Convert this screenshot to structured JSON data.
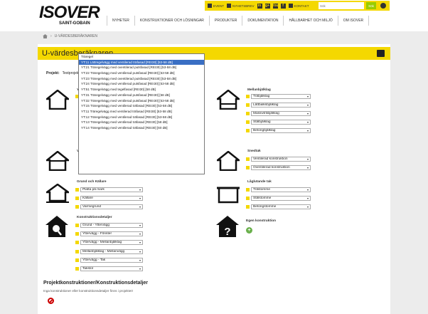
{
  "header": {
    "logo_text": "ISOVER",
    "logo_sub": "SAINT-GOBAIN",
    "topbar": {
      "event": "EVENT",
      "news": "NYHETSBREV",
      "contact": "KONTAKT",
      "social": [
        "in",
        "g+",
        "You",
        "f"
      ]
    },
    "search_placeholder": "Sök",
    "search_button": "Sök",
    "nav": [
      "NYHETER",
      "KONSTRUKTIONER OCH LÖSNINGAR",
      "PRODUKTER",
      "DOKUMENTATION",
      "HÅLLBARHET OCH MILJÖ",
      "OM ISOVER"
    ]
  },
  "breadcrumb": {
    "current": "U-VÄRDESBERÄKNAREN"
  },
  "page": {
    "title": "U-värdesberäknaren",
    "project_label": "Projekt:",
    "project_value": "Testprojekt"
  },
  "sections": {
    "yttervaggar": {
      "title": "Ytterväggar",
      "selected": "Träregel"
    },
    "mellanbjalklag": {
      "title": "Mellanbjälklag",
      "items": [
        "Träbjälklag",
        "Lättbalksbjälklag",
        "Massivträbjälklag",
        "Stålbjälklag",
        "Betongbjälklag"
      ]
    },
    "vindsbjalklag": {
      "title": "V"
    },
    "snedtak": {
      "title": "Snedtak",
      "items": [
        "Ventilerad konstruktion",
        "Oventilerad konstruktion"
      ]
    },
    "grund": {
      "title": "Grund och Källare",
      "items": [
        "Platta på mark",
        "Källare",
        "Varmegrund"
      ]
    },
    "lagl_tak": {
      "title": "Låglutande tak",
      "items": [
        "Trästomme",
        "Stålstomme",
        "Betongstomme"
      ]
    },
    "konstruktionsdetaljer": {
      "title": "Konstruktionsdetaljer",
      "items": [
        "Grund - Yttervägg",
        "Yttervägg - Fönster",
        "Yttervägg - Mellanbjälklag",
        "Mellanbjälklag - Mellanvägg",
        "Yttervägg - Tak",
        "Takstol"
      ]
    },
    "egen": {
      "title": "Egen konstruktion",
      "add": "+"
    }
  },
  "dropdown": {
    "options": [
      "Träregel",
      "YT:11 Lättregelvägg med ventilerad träfasad [REI30] [53-58 dB]",
      "YT:21 Träregelvägg med oventilerad putsfasad [REI30] [53-58 dB]",
      "YT:22 Träregelvägg med ventilerad putsfasad [REI30] [53-58 dB]",
      "YT:23 Träregelvägg med oventilerad putsfasad [REI30] [53-58 dB]",
      "YT:24 Träregelvägg med ventilerad putsfasad [REI30] [53-58 dB]",
      "YT:51 Träregelvägg med tegelfasad [REI30] [58 dB]",
      "YT:31 Träregelvägg med ventilerad putsfasad [REI30] [58 dB]",
      "YT:32 Träregelvägg med ventilerad putsfasad [REI30] [53-58 dB]",
      "YT:15 Träregelvägg med ventilerad träfasad [REI30] [53-58 dB]",
      "YT:11 Träregelvägg med ventilerad träfasad [REI30] [53-58 dB]",
      "YT:12 Träregelvägg med ventilerad träfasad [REI30] [53-58 dB]",
      "YT:13 Träregelvägg med ventilerad träfasad [REI30] [58 dB]",
      "YT:14 Träregelvägg med ventilerad träfasad [REI30] [60 dB]"
    ],
    "highlighted_index": 1
  },
  "bottom": {
    "title": "Projektkonstruktioner/Konstruktionsdetaljer",
    "text": "Inga konstruktioner eller konstruktionsdetaljer finns i projektet!"
  }
}
